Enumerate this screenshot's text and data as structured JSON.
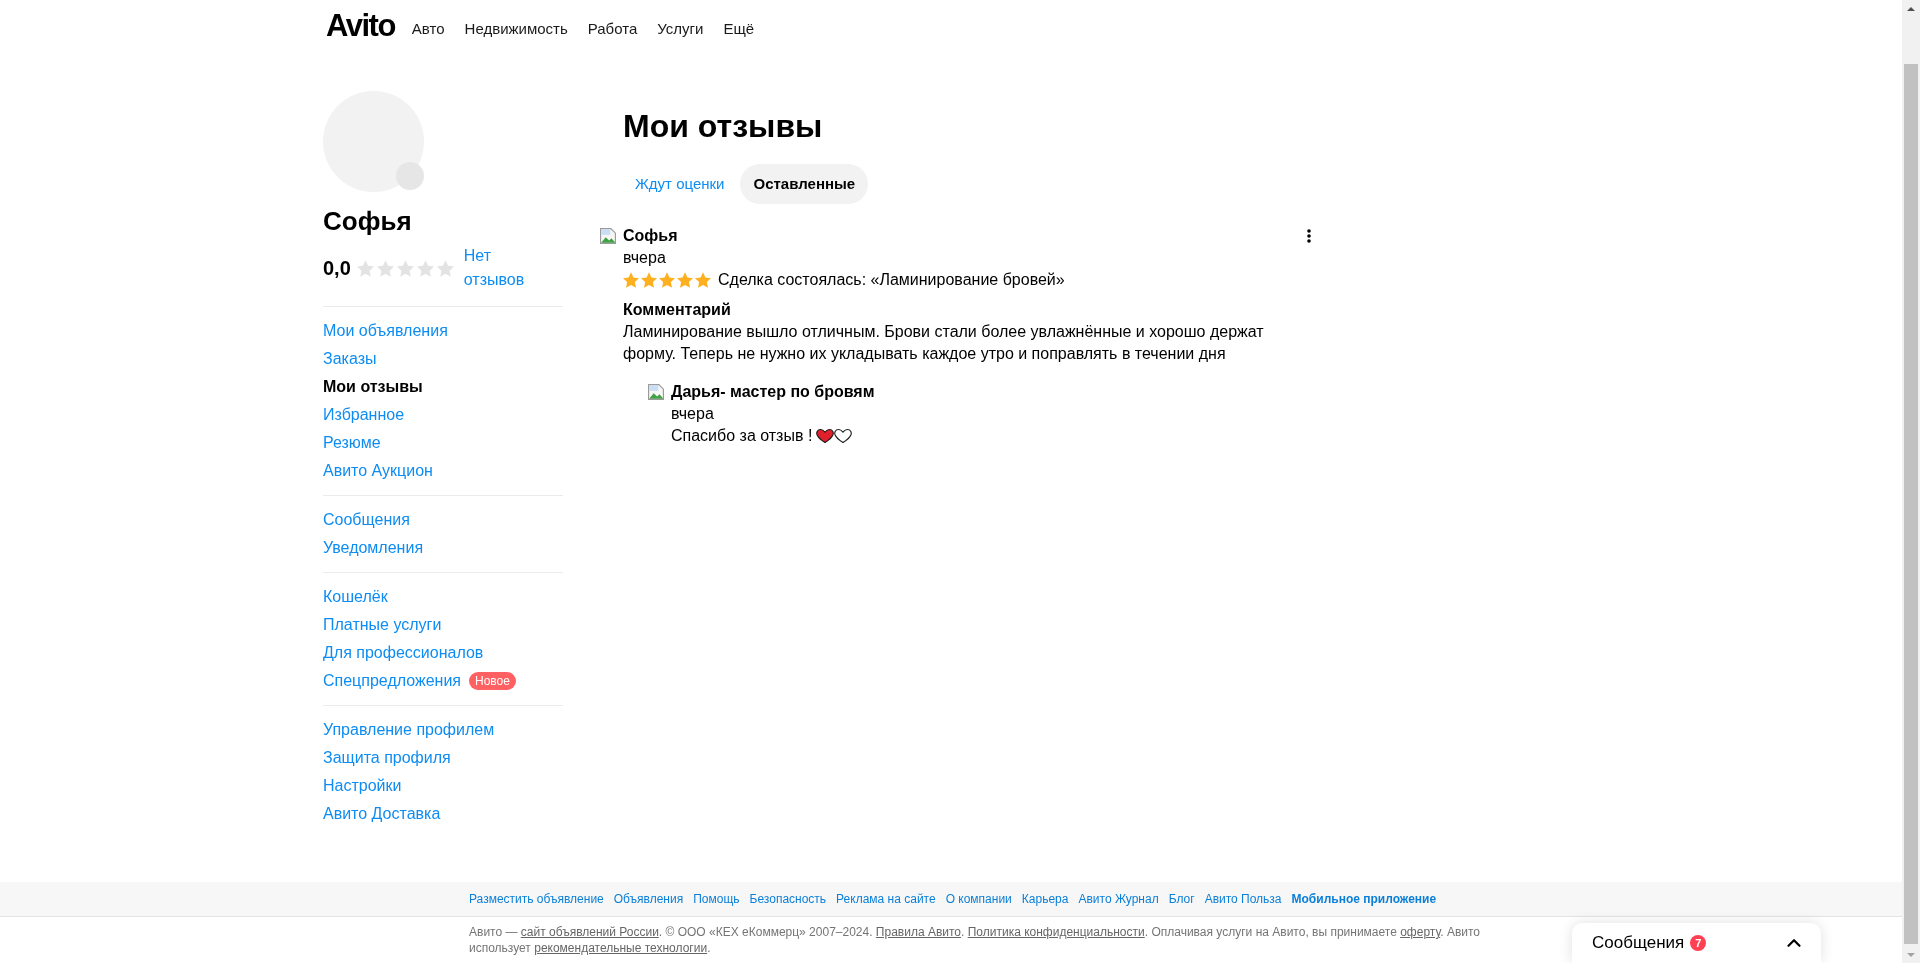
{
  "header": {
    "logo": "Avito",
    "nav": [
      "Авто",
      "Недвижимость",
      "Работа",
      "Услуги",
      "Ещё"
    ]
  },
  "profile": {
    "name": "Софья",
    "rating": "0,0",
    "stars": 0,
    "reviews_link": "Нет отзывов"
  },
  "sidebar": {
    "groups": [
      {
        "items": [
          {
            "label": "Мои объявления",
            "selected": false
          },
          {
            "label": "Заказы",
            "selected": false
          },
          {
            "label": "Мои отзывы",
            "selected": true
          },
          {
            "label": "Избранное",
            "selected": false
          },
          {
            "label": "Резюме",
            "selected": false
          },
          {
            "label": "Авито Аукцион",
            "selected": false
          }
        ]
      },
      {
        "items": [
          {
            "label": "Сообщения",
            "selected": false
          },
          {
            "label": "Уведомления",
            "selected": false
          }
        ]
      },
      {
        "items": [
          {
            "label": "Кошелёк",
            "selected": false
          },
          {
            "label": "Платные услуги",
            "selected": false
          },
          {
            "label": "Для профессионалов",
            "selected": false
          },
          {
            "label": "Спецпредложения",
            "selected": false,
            "badge": "Новое"
          }
        ]
      },
      {
        "items": [
          {
            "label": "Управление профилем",
            "selected": false
          },
          {
            "label": "Защита профиля",
            "selected": false
          },
          {
            "label": "Настройки",
            "selected": false
          },
          {
            "label": "Авито Доставка",
            "selected": false
          }
        ]
      }
    ]
  },
  "page_title": "Мои отзывы",
  "tabs": [
    {
      "label": "Ждут оценки",
      "selected": false
    },
    {
      "label": "Оставленные",
      "selected": true
    }
  ],
  "reviews": [
    {
      "author": "Софья",
      "date": "вчера",
      "stars": 5,
      "deal": "Сделка состоялась: «Ламинирование бровей»",
      "comment_heading": "Комментарий",
      "comment": "Ламинирование вышло отличным. Брови стали более увлажнённые и хорошо держат форму. Теперь не нужно их укладывать каждое утро и поправлять в течении дня",
      "reply": {
        "author": "Дарья- мастер по бровям",
        "date": "вчера",
        "text": "Спасибо за отзыв !",
        "emoji": [
          {
            "kind": "red_heart"
          },
          {
            "kind": "white_heart"
          }
        ]
      }
    }
  ],
  "footer": {
    "links": [
      {
        "label": "Разместить объявление",
        "bold": false
      },
      {
        "label": "Объявления",
        "bold": false
      },
      {
        "label": "Помощь",
        "bold": false
      },
      {
        "label": "Безопасность",
        "bold": false
      },
      {
        "label": "Реклама на сайте",
        "bold": false
      },
      {
        "label": "О компании",
        "bold": false
      },
      {
        "label": "Карьера",
        "bold": false
      },
      {
        "label": "Авито Журнал",
        "bold": false
      },
      {
        "label": "Блог",
        "bold": false
      },
      {
        "label": "Авито Польза",
        "bold": false
      },
      {
        "label": "Мобильное приложение",
        "bold": true
      }
    ],
    "legal": [
      {
        "kind": "text",
        "text": "Авито — "
      },
      {
        "kind": "link",
        "text": "сайт объявлений России"
      },
      {
        "kind": "text",
        "text": ". © ООО «КЕХ еКоммерц» 2007–2024. "
      },
      {
        "kind": "link",
        "text": "Правила Авито"
      },
      {
        "kind": "text",
        "text": ". "
      },
      {
        "kind": "link",
        "text": "Политика конфиденциальности"
      },
      {
        "kind": "text",
        "text": ". Оплачивая услуги на Авито, вы принимаете "
      },
      {
        "kind": "link",
        "text": "оферту"
      },
      {
        "kind": "text",
        "text": ". Авито использует "
      },
      {
        "kind": "link",
        "text": "рекомендательные технологии"
      },
      {
        "kind": "text",
        "text": "."
      }
    ]
  },
  "messages_widget": {
    "label": "Сообщения",
    "count": "7"
  }
}
